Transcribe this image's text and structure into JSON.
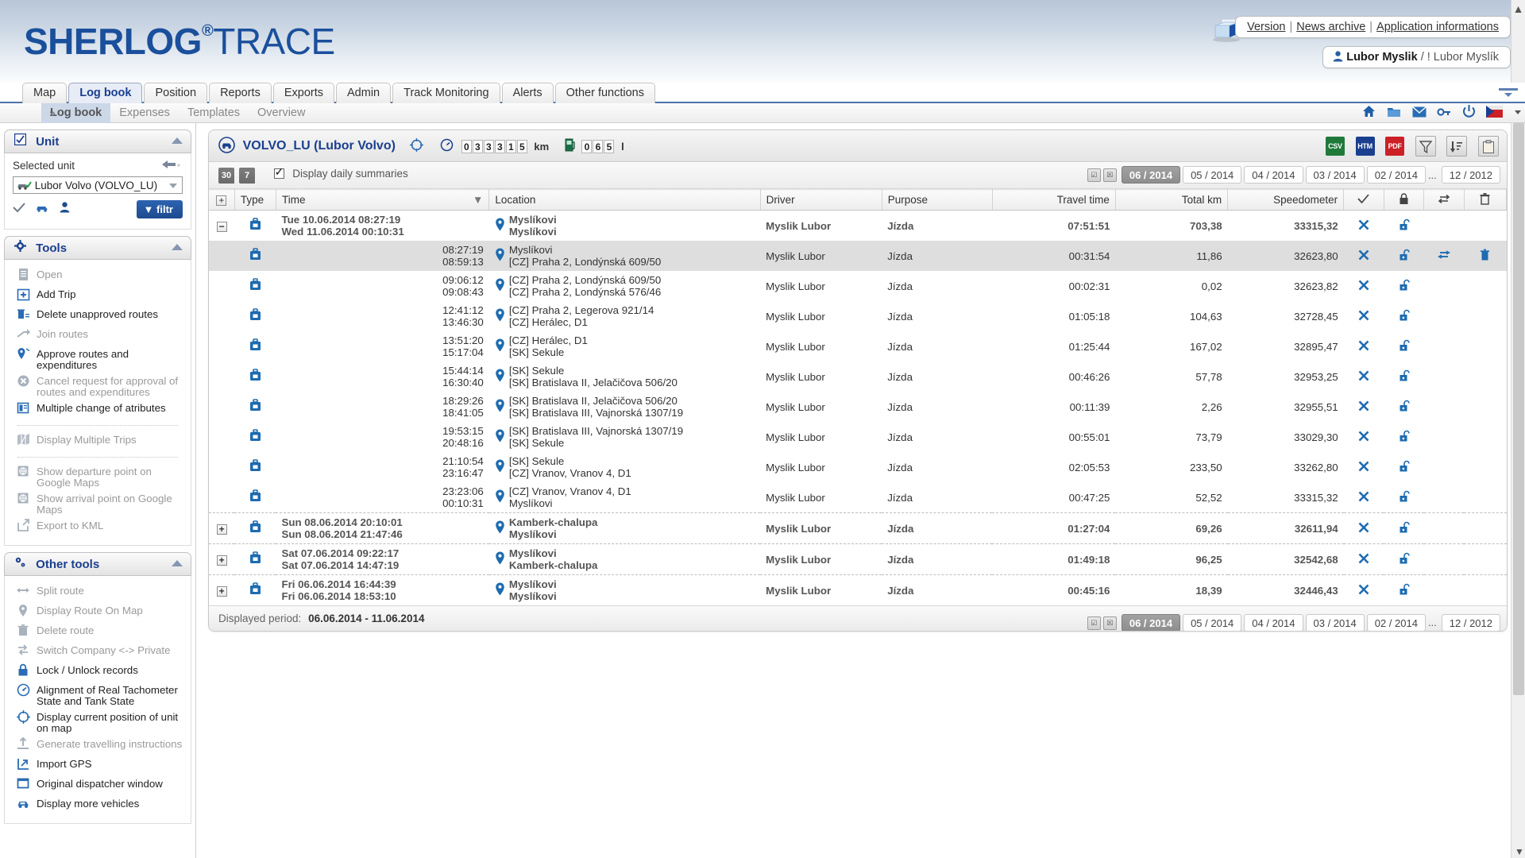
{
  "header": {
    "logo_main": "SHERLOG",
    "logo_reg": "®",
    "logo_sub": "TRACE",
    "links": [
      "Version",
      "News archive",
      "Application informations"
    ],
    "user_name": "Lubor Myslik",
    "user_suffix": "/ ! Lubor Myslík"
  },
  "main_tabs": [
    {
      "label": "Map",
      "active": false
    },
    {
      "label": "Log book",
      "active": true
    },
    {
      "label": "Position",
      "active": false
    },
    {
      "label": "Reports",
      "active": false
    },
    {
      "label": "Exports",
      "active": false
    },
    {
      "label": "Admin",
      "active": false
    },
    {
      "label": "Track Monitoring",
      "active": false
    },
    {
      "label": "Alerts",
      "active": false
    },
    {
      "label": "Other functions",
      "active": false
    }
  ],
  "sub_tabs": [
    {
      "label": "Log book",
      "active": true
    },
    {
      "label": "Expenses",
      "active": false
    },
    {
      "label": "Templates",
      "active": false
    },
    {
      "label": "Overview",
      "active": false
    }
  ],
  "sidebar": {
    "unit_panel": {
      "title": "Unit",
      "selected_unit_label": "Selected unit",
      "selected_unit_value": "Lubor Volvo (VOLVO_LU)",
      "filter_button": "filtr"
    },
    "tools_panel": {
      "title": "Tools",
      "items": [
        {
          "label": "Open",
          "icon": "document-icon",
          "disabled": true
        },
        {
          "label": "Add Trip",
          "icon": "plus-box-icon",
          "disabled": false
        },
        {
          "label": "Delete unapproved routes",
          "icon": "trash-list-icon",
          "disabled": false
        },
        {
          "label": "Join routes",
          "icon": "join-arrow-icon",
          "disabled": true
        },
        {
          "label": "Approve routes and expenditures",
          "icon": "pin-check-icon",
          "disabled": false
        },
        {
          "label": "Cancel request for approval of routes and expenditures",
          "icon": "cancel-circle-icon",
          "disabled": true
        },
        {
          "label": "Multiple change of atributes",
          "icon": "multi-edit-icon",
          "disabled": false
        },
        {
          "sep": true
        },
        {
          "label": "Display Multiple Trips",
          "icon": "map-multi-icon",
          "disabled": true
        },
        {
          "sep": true
        },
        {
          "label": "Show departure point on Google Maps",
          "icon": "globe-pin-icon",
          "disabled": true
        },
        {
          "label": "Show arrival point on Google Maps",
          "icon": "globe-pin-icon",
          "disabled": true
        },
        {
          "label": "Export to KML",
          "icon": "export-arrow-icon",
          "disabled": true
        }
      ]
    },
    "other_tools_panel": {
      "title": "Other tools",
      "items": [
        {
          "label": "Split route",
          "icon": "split-arrows-icon",
          "disabled": true
        },
        {
          "label": "Display Route On Map",
          "icon": "map-pin-icon",
          "disabled": true
        },
        {
          "label": "Delete route",
          "icon": "trash-icon",
          "disabled": true
        },
        {
          "label": "Switch Company <-> Private",
          "icon": "switch-icon",
          "disabled": true
        },
        {
          "label": "Lock / Unlock records",
          "icon": "lock-icon",
          "disabled": false
        },
        {
          "label": "Alignment of Real Tachometer State and Tank State",
          "icon": "gauge-icon",
          "disabled": false
        },
        {
          "label": "Display current position of unit on map",
          "icon": "crosshair-icon",
          "disabled": false
        },
        {
          "label": "Generate travelling instructions",
          "icon": "upload-icon",
          "disabled": true
        },
        {
          "label": "Import GPS",
          "icon": "import-icon",
          "disabled": false
        },
        {
          "label": "Original dispatcher window",
          "icon": "window-icon",
          "disabled": false
        },
        {
          "label": "Display more vehicles",
          "icon": "car-icon",
          "disabled": false
        }
      ]
    }
  },
  "panel": {
    "vehicle_title": "VOLVO_LU (Lubor Volvo)",
    "odometer_digits": [
      "0",
      "3",
      "3",
      "3",
      "1",
      "5"
    ],
    "odometer_unit": "km",
    "fuel_digits": [
      "0",
      "6",
      "5"
    ],
    "fuel_unit": "l",
    "export_formats": [
      "CSV",
      "HTM",
      "PDF"
    ]
  },
  "toolbar": {
    "page_chips": [
      "30",
      "7"
    ],
    "daily_summaries_label": "Display daily summaries",
    "daily_summaries_checked": true,
    "months": [
      "06 / 2014",
      "05 / 2014",
      "04 / 2014",
      "03 / 2014",
      "02 / 2014"
    ],
    "months_dots": "...",
    "month_last": "12 / 2012",
    "active_month": "06 / 2014"
  },
  "table": {
    "columns": [
      "",
      "Type",
      "Time",
      "Location",
      "Driver",
      "Purpose",
      "Travel time",
      "Total km",
      "Speedometer"
    ],
    "rows": [
      {
        "kind": "daily",
        "expander": "−",
        "time1": "Tue 10.06.2014 08:27:19",
        "time2": "Wed 11.06.2014 00:10:31",
        "loc1": "Myslíkovi",
        "loc2": "Myslíkovi",
        "driver": "Myslik Lubor",
        "purpose": "Jízda",
        "travel": "07:51:51",
        "km": "703,38",
        "speedo": "33315,32",
        "actions": [
          "close",
          "unlock"
        ]
      },
      {
        "kind": "sub",
        "selected": true,
        "expander": "",
        "time1": "08:27:19",
        "time2": "08:59:13",
        "loc1": "Myslíkovi",
        "loc2": "[CZ] Praha 2, Londýnská 609/50",
        "driver": "Myslik Lubor",
        "purpose": "Jízda",
        "travel": "00:31:54",
        "km": "11,86",
        "speedo": "32623,80",
        "actions": [
          "close",
          "unlock",
          "swap",
          "delete"
        ]
      },
      {
        "kind": "sub",
        "expander": "",
        "time1": "09:06:12",
        "time2": "09:08:43",
        "loc1": "[CZ] Praha 2, Londýnská 609/50",
        "loc2": "[CZ] Praha 2, Londýnská 576/46",
        "driver": "Myslik Lubor",
        "purpose": "Jízda",
        "travel": "00:02:31",
        "km": "0,02",
        "speedo": "32623,82",
        "actions": [
          "close",
          "unlock"
        ]
      },
      {
        "kind": "sub",
        "expander": "",
        "time1": "12:41:12",
        "time2": "13:46:30",
        "loc1": "[CZ] Praha 2, Legerova 921/14",
        "loc2": "[CZ] Herálec, D1",
        "driver": "Myslik Lubor",
        "purpose": "Jízda",
        "travel": "01:05:18",
        "km": "104,63",
        "speedo": "32728,45",
        "actions": [
          "close",
          "unlock"
        ]
      },
      {
        "kind": "sub",
        "expander": "",
        "time1": "13:51:20",
        "time2": "15:17:04",
        "loc1": "[CZ] Herálec, D1",
        "loc2": "[SK] Sekule",
        "driver": "Myslik Lubor",
        "purpose": "Jízda",
        "travel": "01:25:44",
        "km": "167,02",
        "speedo": "32895,47",
        "actions": [
          "close",
          "unlock"
        ]
      },
      {
        "kind": "sub",
        "expander": "",
        "time1": "15:44:14",
        "time2": "16:30:40",
        "loc1": "[SK] Sekule",
        "loc2": "[SK] Bratislava II, Jelačičova 506/20",
        "driver": "Myslik Lubor",
        "purpose": "Jízda",
        "travel": "00:46:26",
        "km": "57,78",
        "speedo": "32953,25",
        "actions": [
          "close",
          "unlock"
        ]
      },
      {
        "kind": "sub",
        "expander": "",
        "time1": "18:29:26",
        "time2": "18:41:05",
        "loc1": "[SK] Bratislava II, Jelačičova 506/20",
        "loc2": "[SK] Bratislava III, Vajnorská 1307/19",
        "driver": "Myslik Lubor",
        "purpose": "Jízda",
        "travel": "00:11:39",
        "km": "2,26",
        "speedo": "32955,51",
        "actions": [
          "close",
          "unlock"
        ]
      },
      {
        "kind": "sub",
        "expander": "",
        "time1": "19:53:15",
        "time2": "20:48:16",
        "loc1": "[SK] Bratislava III, Vajnorská 1307/19",
        "loc2": "[SK] Sekule",
        "driver": "Myslik Lubor",
        "purpose": "Jízda",
        "travel": "00:55:01",
        "km": "73,79",
        "speedo": "33029,30",
        "actions": [
          "close",
          "unlock"
        ]
      },
      {
        "kind": "sub",
        "expander": "",
        "time1": "21:10:54",
        "time2": "23:16:47",
        "loc1": "[SK] Sekule",
        "loc2": "[CZ] Vranov, Vranov 4, D1",
        "driver": "Myslik Lubor",
        "purpose": "Jízda",
        "travel": "02:05:53",
        "km": "233,50",
        "speedo": "33262,80",
        "actions": [
          "close",
          "unlock"
        ]
      },
      {
        "kind": "sub",
        "expander": "",
        "time1": "23:23:06",
        "time2": "00:10:31",
        "loc1": "[CZ] Vranov, Vranov 4, D1",
        "loc2": "Myslíkovi",
        "driver": "Myslik Lubor",
        "purpose": "Jízda",
        "travel": "00:47:25",
        "km": "52,52",
        "speedo": "33315,32",
        "actions": [
          "close",
          "unlock"
        ]
      },
      {
        "kind": "daily",
        "sepabove": true,
        "expander": "+",
        "time1": "Sun 08.06.2014 20:10:01",
        "time2": "Sun 08.06.2014 21:47:46",
        "loc1": "Kamberk-chalupa",
        "loc2": "Myslíkovi",
        "driver": "Myslik Lubor",
        "purpose": "Jízda",
        "travel": "01:27:04",
        "km": "69,26",
        "speedo": "32611,94",
        "actions": [
          "close",
          "unlock"
        ]
      },
      {
        "kind": "daily",
        "sepabove": true,
        "expander": "+",
        "time1": "Sat 07.06.2014 09:22:17",
        "time2": "Sat 07.06.2014 14:47:19",
        "loc1": "Myslíkovi",
        "loc2": "Kamberk-chalupa",
        "driver": "Myslik Lubor",
        "purpose": "Jízda",
        "travel": "01:49:18",
        "km": "96,25",
        "speedo": "32542,68",
        "actions": [
          "close",
          "unlock"
        ]
      },
      {
        "kind": "daily",
        "sepabove": true,
        "expander": "+",
        "time1": "Fri 06.06.2014 16:44:39",
        "time2": "Fri 06.06.2014 18:53:10",
        "loc1": "Myslíkovi",
        "loc2": "Myslíkovi",
        "driver": "Myslik Lubor",
        "purpose": "Jízda",
        "travel": "00:45:16",
        "km": "18,39",
        "speedo": "32446,43",
        "actions": [
          "close",
          "unlock"
        ]
      }
    ]
  },
  "status": {
    "period_label": "Displayed period:",
    "period_value": "06.06.2014 - 11.06.2014"
  },
  "colors": {
    "brand_blue": "#1a3f8f",
    "link_blue": "#1a5fa8",
    "accent_icon": "#1f6fb5"
  }
}
